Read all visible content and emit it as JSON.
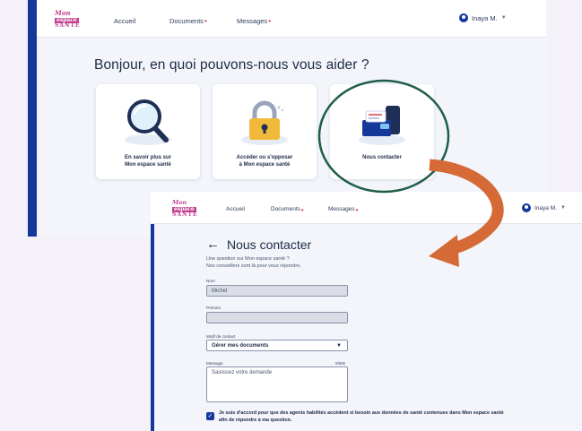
{
  "colors": {
    "brand_blue": "#16389b",
    "logo_pink": "#c2418f",
    "highlight_ring": "#1f5e48",
    "arrow_orange": "#d56a37"
  },
  "home": {
    "logo": {
      "line1": "Mon",
      "line2": "espace",
      "line3": "SANTÉ"
    },
    "nav": {
      "home": "Accueil",
      "documents": "Documents",
      "messages": "Messages",
      "badge": "•"
    },
    "user": "Inaya M.",
    "greeting": "Bonjour, en quoi pouvons-nous vous aider ?",
    "cards": [
      {
        "icon": "magnifier-icon",
        "label": "En savoir plus sur\nMon espace santé"
      },
      {
        "icon": "padlock-icon",
        "label": "Accéder ou s'opposer\nà Mon espace santé"
      },
      {
        "icon": "contact-phone-icon",
        "label": "Nous contacter"
      }
    ]
  },
  "contact": {
    "logo": {
      "line1": "Mon",
      "line2": "espace",
      "line3": "SANTÉ"
    },
    "nav": {
      "home": "Accueil",
      "documents": "Documents",
      "messages": "Messages",
      "badge": "•"
    },
    "user": "Inaya M.",
    "title": "Nous contacter",
    "back_icon": "←",
    "intro_line1": "Une question sur Mon espace santé ?",
    "intro_line2": "Nos conseillers sont là pour vous répondre.",
    "form": {
      "nom_label": "Nom",
      "nom_value": "Michel",
      "prenom_label": "Prénom",
      "prenom_value": "",
      "motif_label": "Motif de contact",
      "motif_value": "Gérer mes documents",
      "message_label": "Message",
      "message_counter": "0/500",
      "message_placeholder": "Saisissez votre demande"
    },
    "consent": {
      "checked": true,
      "check_glyph": "✓",
      "text": "Je suis d'accord pour que des agents habilités accèdent si besoin aux données de santé contenues dans Mon espace santé afin de répondre à ma question."
    }
  }
}
